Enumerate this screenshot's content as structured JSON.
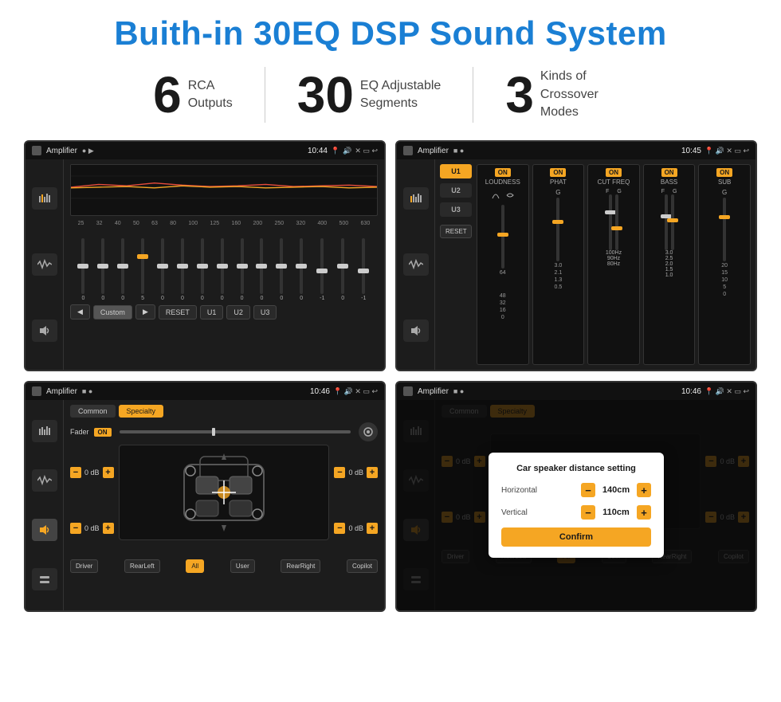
{
  "header": {
    "title": "Buith-in 30EQ DSP Sound System"
  },
  "stats": [
    {
      "number": "6",
      "text_line1": "RCA",
      "text_line2": "Outputs"
    },
    {
      "number": "30",
      "text_line1": "EQ Adjustable",
      "text_line2": "Segments"
    },
    {
      "number": "3",
      "text_line1": "Kinds of",
      "text_line2": "Crossover Modes"
    }
  ],
  "screen1": {
    "bar_title": "Amplifier",
    "time": "10:44",
    "preset": "Custom",
    "freqs": [
      "25",
      "32",
      "40",
      "50",
      "63",
      "80",
      "100",
      "125",
      "160",
      "200",
      "250",
      "320",
      "400",
      "500",
      "630"
    ],
    "vals": [
      "0",
      "0",
      "0",
      "5",
      "0",
      "0",
      "0",
      "0",
      "0",
      "0",
      "0",
      "0",
      "-1",
      "0",
      "-1"
    ],
    "buttons": [
      "Custom",
      "RESET",
      "U1",
      "U2",
      "U3"
    ]
  },
  "screen2": {
    "bar_title": "Amplifier",
    "time": "10:45",
    "presets": [
      "U1",
      "U2",
      "U3"
    ],
    "channels": [
      {
        "label": "LOUDNESS",
        "on": true,
        "val": ""
      },
      {
        "label": "PHAT",
        "on": true,
        "val": ""
      },
      {
        "label": "CUT FREQ",
        "on": true,
        "val": ""
      },
      {
        "label": "BASS",
        "on": true,
        "val": ""
      },
      {
        "label": "SUB",
        "on": true,
        "val": ""
      }
    ],
    "reset_label": "RESET"
  },
  "screen3": {
    "bar_title": "Amplifier",
    "time": "10:46",
    "tabs": [
      "Common",
      "Specialty"
    ],
    "active_tab": "Specialty",
    "fader_label": "Fader",
    "fader_on": "ON",
    "vol_left_top": "0 dB",
    "vol_left_bot": "0 dB",
    "vol_right_top": "0 dB",
    "vol_right_bot": "0 dB",
    "speaker_btns": [
      "Driver",
      "RearLeft",
      "All",
      "User",
      "RearRight",
      "Copilot"
    ]
  },
  "screen4": {
    "bar_title": "Amplifier",
    "time": "10:46",
    "tabs": [
      "Common",
      "Specialty"
    ],
    "dialog": {
      "title": "Car speaker distance setting",
      "fields": [
        {
          "label": "Horizontal",
          "value": "140cm"
        },
        {
          "label": "Vertical",
          "value": "110cm"
        }
      ],
      "confirm_label": "Confirm"
    },
    "vol_right_top": "0 dB",
    "vol_right_bot": "0 dB",
    "speaker_btns": [
      "Driver",
      "RearLeft",
      "All",
      "User",
      "RearRight",
      "Copilot"
    ]
  }
}
